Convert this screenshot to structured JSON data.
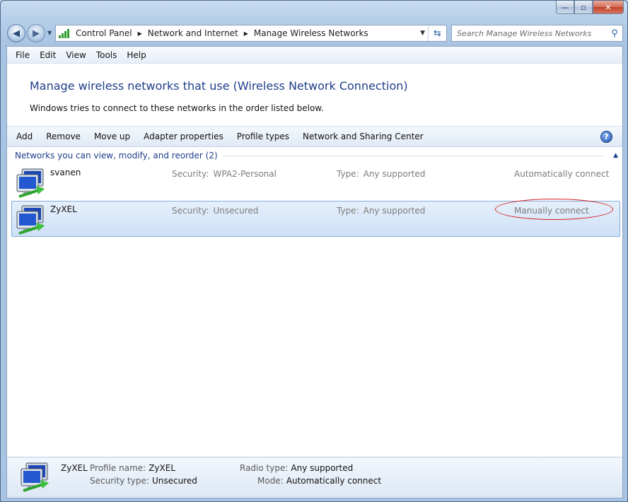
{
  "window": {
    "caption_buttons": [
      "—",
      "▫",
      "✕"
    ]
  },
  "nav": {
    "back_glyph": "◀",
    "forward_glyph": "▶",
    "recent_glyph": "▼"
  },
  "address": {
    "breadcrumbs": [
      "Control Panel",
      "Network and Internet",
      "Manage Wireless Networks"
    ],
    "separator": "▶",
    "drop_glyph": "▼",
    "refresh_glyph": "⇆"
  },
  "search": {
    "placeholder": "Search Manage Wireless Networks",
    "icon_glyph": "⚲"
  },
  "menu": {
    "items": [
      "File",
      "Edit",
      "View",
      "Tools",
      "Help"
    ]
  },
  "header": {
    "title": "Manage wireless networks that use (Wireless Network Connection)",
    "subtitle": "Windows tries to connect to these networks in the order listed below."
  },
  "commands": {
    "items": [
      "Add",
      "Remove",
      "Move up",
      "Adapter properties",
      "Profile types",
      "Network and Sharing Center"
    ],
    "help_glyph": "?"
  },
  "group": {
    "title": "Networks you can view, modify, and reorder (2)",
    "chevron": "▲"
  },
  "networks": [
    {
      "name": "svanen",
      "security_label": "Security:",
      "security_value": "WPA2-Personal",
      "type_label": "Type:",
      "type_value": "Any supported",
      "mode": "Automatically connect"
    },
    {
      "name": "ZyXEL",
      "security_label": "Security:",
      "security_value": "Unsecured",
      "type_label": "Type:",
      "type_value": "Any supported",
      "mode": "Manually connect"
    }
  ],
  "details": {
    "name": "ZyXEL",
    "profile_label": "Profile name:",
    "profile_value": "ZyXEL",
    "security_label": "Security type:",
    "security_value": "Unsecured",
    "radio_label": "Radio type:",
    "radio_value": "Any supported",
    "mode_label": "Mode:",
    "mode_value": "Automatically connect"
  },
  "colors": {
    "selected_row": "#cde0f6",
    "annotation": "#d81f1f",
    "heading_blue": "#1f3d8a"
  }
}
